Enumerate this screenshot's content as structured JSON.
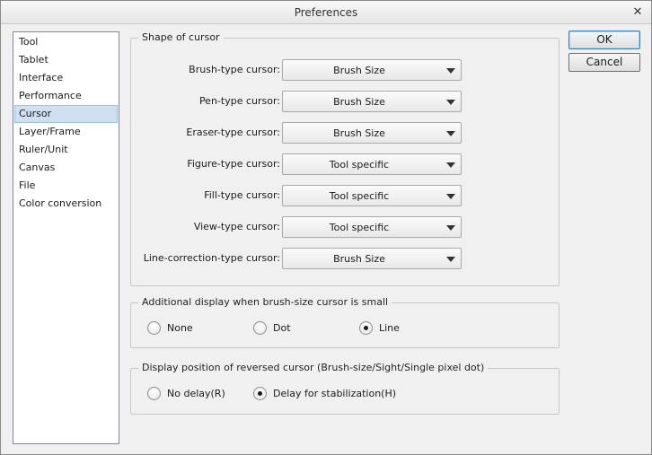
{
  "window": {
    "title": "Preferences",
    "close_glyph": "✕"
  },
  "sidebar": {
    "items": [
      {
        "label": "Tool"
      },
      {
        "label": "Tablet"
      },
      {
        "label": "Interface"
      },
      {
        "label": "Performance"
      },
      {
        "label": "Cursor"
      },
      {
        "label": "Layer/Frame"
      },
      {
        "label": "Ruler/Unit"
      },
      {
        "label": "Canvas"
      },
      {
        "label": "File"
      },
      {
        "label": "Color conversion"
      }
    ],
    "selected": "Cursor"
  },
  "shape_of_cursor": {
    "title": "Shape of cursor",
    "rows": [
      {
        "label": "Brush-type cursor:",
        "value": "Brush Size"
      },
      {
        "label": "Pen-type cursor:",
        "value": "Brush Size"
      },
      {
        "label": "Eraser-type cursor:",
        "value": "Brush Size"
      },
      {
        "label": "Figure-type cursor:",
        "value": "Tool specific"
      },
      {
        "label": "Fill-type cursor:",
        "value": "Tool specific"
      },
      {
        "label": "View-type cursor:",
        "value": "Tool specific"
      },
      {
        "label": "Line-correction-type cursor:",
        "value": "Brush Size"
      }
    ]
  },
  "additional_display": {
    "title": "Additional display when brush-size cursor is small",
    "options": [
      {
        "label": "None",
        "checked": false
      },
      {
        "label": "Dot",
        "checked": false
      },
      {
        "label": "Line",
        "checked": true
      }
    ]
  },
  "reversed_cursor": {
    "title": "Display position of reversed cursor (Brush-size/Sight/Single pixel dot)",
    "options": [
      {
        "label": "No delay(R)",
        "checked": false
      },
      {
        "label": "Delay for stabilization(H)",
        "checked": true
      }
    ]
  },
  "buttons": {
    "ok": "OK",
    "cancel": "Cancel"
  }
}
